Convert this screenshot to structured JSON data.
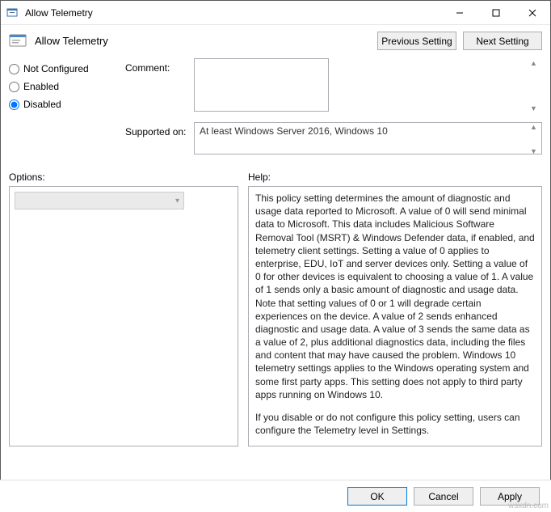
{
  "window": {
    "title": "Allow Telemetry"
  },
  "header": {
    "policy_title": "Allow Telemetry",
    "prev_btn": "Previous Setting",
    "next_btn": "Next Setting"
  },
  "state": {
    "options": {
      "not_configured": "Not Configured",
      "enabled": "Enabled",
      "disabled": "Disabled"
    },
    "selected": "disabled"
  },
  "fields": {
    "comment_label": "Comment:",
    "comment_value": "",
    "supported_label": "Supported on:",
    "supported_value": "At least Windows Server 2016, Windows 10"
  },
  "sections": {
    "options_label": "Options:",
    "help_label": "Help:"
  },
  "help": {
    "p1": "This policy setting determines the amount of diagnostic and usage data reported to Microsoft. A value of 0 will send minimal data to Microsoft. This data includes Malicious Software Removal Tool (MSRT) & Windows Defender data, if enabled, and telemetry client settings. Setting a value of 0 applies to enterprise, EDU, IoT and server devices only. Setting a value of 0 for other devices is equivalent to choosing a value of 1. A value of 1 sends only a basic amount of diagnostic and usage data. Note that setting values of 0 or 1 will degrade certain experiences on the device. A value of 2 sends enhanced diagnostic and usage data. A value of 3 sends the same data as a value of 2, plus additional diagnostics data, including the files and content that may have caused the problem. Windows 10 telemetry settings applies to the Windows operating system and some first party apps. This setting does not apply to third party apps running on Windows 10.",
    "p2": "If you disable or do not configure this policy setting, users can configure the Telemetry level in Settings."
  },
  "footer": {
    "ok": "OK",
    "cancel": "Cancel",
    "apply": "Apply"
  },
  "watermark": "wsxdn.com"
}
